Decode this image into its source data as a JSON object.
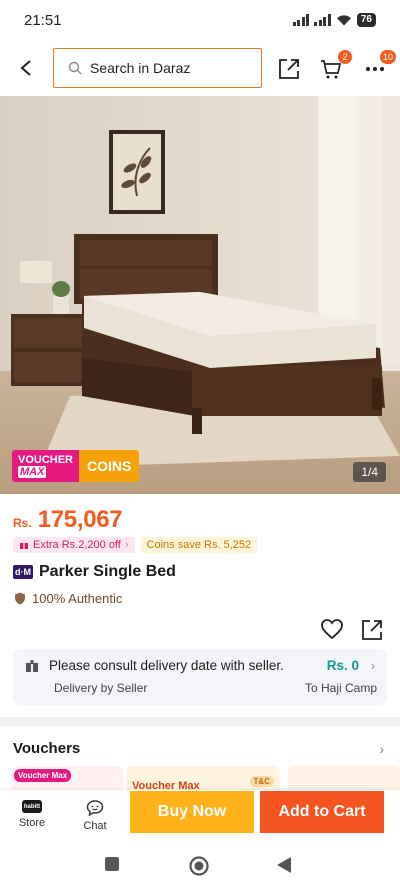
{
  "status_bar": {
    "time": "21:51",
    "battery": "76"
  },
  "header": {
    "search_placeholder": "Search in Daraz",
    "cart_count": "2",
    "more_count": "10"
  },
  "gallery": {
    "counter": "1/4"
  },
  "promo": {
    "voucher_line1": "VOUCHER",
    "voucher_line2": "MAX",
    "coins_label": "COINS"
  },
  "product": {
    "currency": "Rs.",
    "price": "175,067",
    "extra_off": "Extra Rs.2,200 off",
    "coins_save": "Coins save Rs. 5,252",
    "brand_badge": "d·M",
    "title": "Parker Single Bed",
    "authentic": "100% Authentic"
  },
  "delivery": {
    "message": "Please consult delivery date with seller.",
    "price": "Rs. 0",
    "by": "Delivery by Seller",
    "to": "To Haji Camp"
  },
  "vouchers": {
    "title": "Vouchers",
    "card1_tag": "Voucher Max",
    "card2_title": "Voucher Max",
    "card2_tag": "T&C"
  },
  "bottom_bar": {
    "store_logo": "habitt",
    "store_label": "Store",
    "chat_label": "Chat",
    "buy_now": "Buy Now",
    "add_to_cart": "Add to Cart"
  },
  "colors": {
    "accent": "#f35b1f",
    "buy_now": "#ffb31a",
    "add_to_cart": "#f5531f",
    "free_delivery": "#0f9d8e"
  }
}
